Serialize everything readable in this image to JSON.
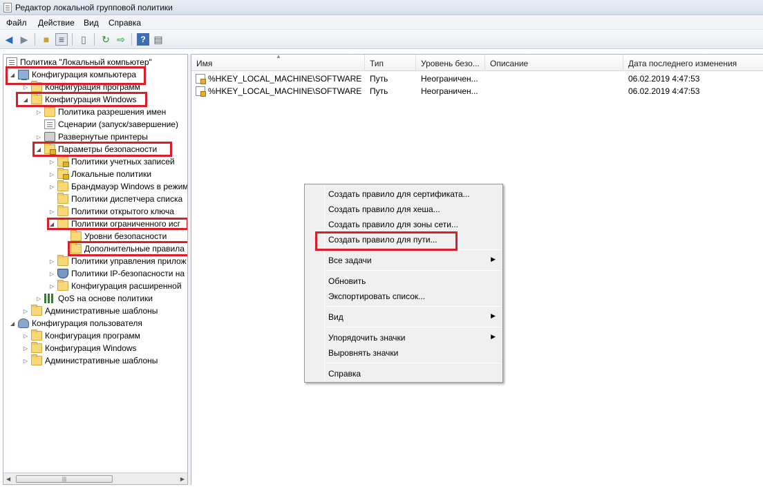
{
  "window": {
    "title": "Редактор локальной групповой политики"
  },
  "menu": [
    "Файл",
    "Действие",
    "Вид",
    "Справка"
  ],
  "toolbar_icons": [
    "back-arrow-icon",
    "forward-arrow-icon",
    "up-folder-icon",
    "show-hide-tree-icon",
    "clipboard-icon",
    "refresh-icon",
    "export-list-icon",
    "help-icon",
    "properties-icon"
  ],
  "tree": {
    "root": "Политика \"Локальный компьютер\"",
    "computer_config": "Конфигурация компьютера",
    "software_settings": "Конфигурация программ",
    "windows_settings": "Конфигурация Windows",
    "name_resolution_policy": "Политика разрешения имен",
    "scripts": "Сценарии (запуск/завершение)",
    "deployed_printers": "Развернутые принтеры",
    "security_settings": "Параметры безопасности",
    "account_policies": "Политики учетных записей",
    "local_policies": "Локальные политики",
    "windows_firewall": "Брандмауэр Windows в режим",
    "network_list_manager": "Политики диспетчера списка",
    "public_key_policies": "Политики открытого ключа",
    "software_restriction": "Политики ограниченного исг",
    "security_levels": "Уровни безопасности",
    "additional_rules": "Дополнительные правила",
    "app_control": "Политики управления прилож",
    "ip_security": "Политики IP-безопасности на",
    "advanced_audit": "Конфигурация расширенной",
    "qos": "QoS на основе политики",
    "admin_templates": "Административные шаблоны",
    "user_config": "Конфигурация пользователя",
    "user_software_settings": "Конфигурация программ",
    "user_windows_settings": "Конфигурация Windows",
    "user_admin_templates": "Административные шаблоны"
  },
  "list": {
    "columns": [
      "Имя",
      "Тип",
      "Уровень безо...",
      "Описание",
      "Дата последнего изменения"
    ],
    "rows": [
      [
        "%HKEY_LOCAL_MACHINE\\SOFTWARE\\...",
        "Путь",
        "Неограничен...",
        "",
        "06.02.2019  4:47:53"
      ],
      [
        "%HKEY_LOCAL_MACHINE\\SOFTWARE\\...",
        "Путь",
        "Неограничен...",
        "",
        "06.02.2019  4:47:53"
      ]
    ]
  },
  "context_menu": {
    "cert_rule": "Создать правило для сертификата...",
    "hash_rule": "Создать правило для хеша...",
    "zone_rule": "Создать правило для зоны сети...",
    "path_rule": "Создать правило для пути...",
    "all_tasks": "Все задачи",
    "refresh": "Обновить",
    "export_list": "Экспортировать список...",
    "view": "Вид",
    "arrange_icons": "Упорядочить значки",
    "line_up_icons": "Выровнять значки",
    "help": "Справка"
  },
  "accent_colors": {
    "highlight_box": "#d9202a",
    "folder": "#f7d97a"
  }
}
